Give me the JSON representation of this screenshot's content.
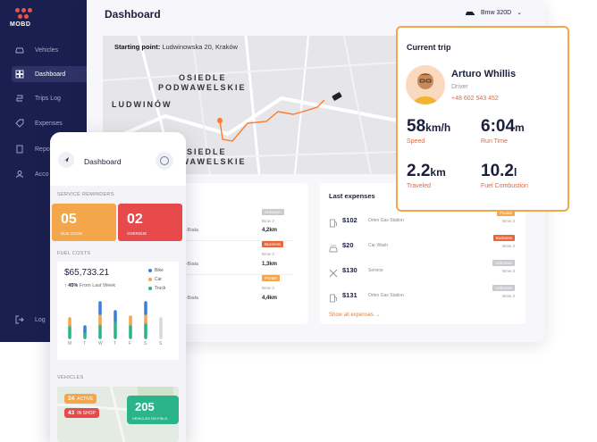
{
  "sidebar": {
    "logo": "MOBD",
    "items": [
      {
        "label": "Vehicles",
        "icon": "car-icon"
      },
      {
        "label": "Dashboard",
        "icon": "dashboard-icon"
      },
      {
        "label": "Trips Log",
        "icon": "route-icon"
      },
      {
        "label": "Expenses",
        "icon": "tag-icon"
      },
      {
        "label": "Repo",
        "icon": "report-icon"
      },
      {
        "label": "Acco",
        "icon": "user-icon"
      }
    ],
    "logout": "Log"
  },
  "header": {
    "title": "Dashboard",
    "car_select": "Bmw 320D"
  },
  "map": {
    "start_label": "Starting point:",
    "start_value": "Ludwinowska 20, Kraków",
    "labels": [
      "OSIEDLE",
      "PODWAWELSKIE",
      "LUDWINÓW",
      "OSIEDLE",
      "PODWAWELSKIE"
    ]
  },
  "current_trip": {
    "title": "Current trip",
    "driver_name": "Arturo Whillis",
    "driver_role": "Driver",
    "driver_phone": "+48 602 543 452",
    "speed": {
      "value": "58",
      "unit": "km/h",
      "label": "Speed"
    },
    "run_time": {
      "value": "6:04",
      "unit": "m",
      "label": "Run Time"
    },
    "traveled": {
      "value": "2.2",
      "unit": "km",
      "label": "Traveled"
    },
    "fuel": {
      "value": "10.2",
      "unit": "l",
      "label": "Fuel Combustion"
    }
  },
  "trips": {
    "rows": [
      {
        "line1": "akow",
        "line2": "alsko-Biała",
        "badge": "Unknown",
        "car": "Bmw 3",
        "km": "4,2km",
        "badge_color": "#c9c9cf"
      },
      {
        "line1": "akow",
        "line2": "alsko-Biała",
        "badge": "Business",
        "car": "Bmw 3",
        "km": "1,3km",
        "badge_color": "#e8663a"
      },
      {
        "line1": "akow",
        "line2": "alsko-Biała",
        "badge": "Private",
        "car": "Bmw 3",
        "km": "4,4km",
        "badge_color": "#f3a64a"
      }
    ]
  },
  "expenses": {
    "title": "Last expenses",
    "show_all": "Show all expenses →",
    "rows": [
      {
        "amount": "$102",
        "location": "Orlen Gas Station",
        "badge": "Private",
        "car": "Bmw 3",
        "icon": "gas-pump-icon",
        "badge_color": "#f3a64a"
      },
      {
        "amount": "$20",
        "location": "Car Wash",
        "badge": "Business",
        "car": "Bmw 3",
        "icon": "car-wash-icon",
        "badge_color": "#e8663a"
      },
      {
        "amount": "$130",
        "location": "Service",
        "badge": "Unknown",
        "car": "Bmw 3",
        "icon": "wrench-icon",
        "badge_color": "#c9c9cf"
      },
      {
        "amount": "$131",
        "location": "Orlen Gas Station",
        "badge": "Unknown",
        "car": "Bmw 3",
        "icon": "gas-pump-icon",
        "badge_color": "#c9c9cf"
      }
    ]
  },
  "mobile": {
    "title": "Dashboard",
    "reminders_title": "SERVICE REMINDERS",
    "due_soon": {
      "value": "05",
      "label": "DUE SOON",
      "color": "#f3a64a"
    },
    "overdue": {
      "value": "02",
      "label": "OVERDUE",
      "color": "#e8494a"
    },
    "fuel_title": "FUEL COSTS",
    "fuel_total": "$65,733.21",
    "fuel_change_pct": "45%",
    "fuel_change_text": "From Last Week",
    "legend": [
      {
        "name": "Bike",
        "color": "#3b7fd9"
      },
      {
        "name": "Car",
        "color": "#f3a64a"
      },
      {
        "name": "Truck",
        "color": "#2bb38a"
      }
    ],
    "chart_days": [
      "M",
      "T",
      "W",
      "T",
      "F",
      "S",
      "S"
    ],
    "vehicles_title": "VEHICLES",
    "v_active": {
      "value": "24",
      "label": "ACTIVE",
      "color": "#f3a64a"
    },
    "v_shop": {
      "value": "43",
      "label": "IN SHOP",
      "color": "#e8494a"
    },
    "v_field": {
      "value": "205",
      "label": "VEHICLES ON FIELD",
      "color": "#2bb38a"
    }
  }
}
